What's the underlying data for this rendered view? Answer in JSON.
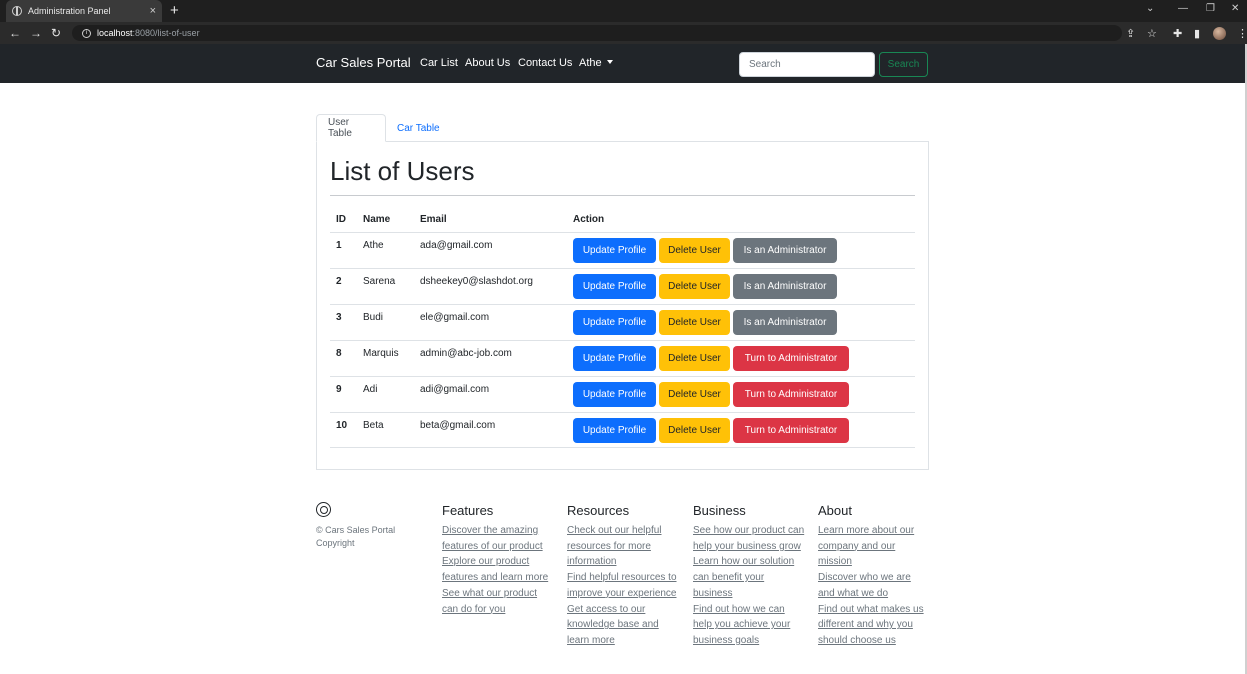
{
  "browser": {
    "tab_title": "Administration Panel",
    "tab_close": "×",
    "new_tab": "+",
    "url_host": "localhost",
    "url_path": ":8080/list-of-user"
  },
  "navbar": {
    "brand": "Car Sales Portal",
    "links": [
      "Car List",
      "About Us",
      "Contact Us",
      "Athe"
    ],
    "search_placeholder": "Search",
    "search_button": "Search"
  },
  "tabs": [
    "User Table",
    "Car Table"
  ],
  "panel": {
    "title": "List of Users",
    "headers": [
      "ID",
      "Name",
      "Email",
      "Action"
    ],
    "rows": [
      {
        "id": "1",
        "name": "Athe",
        "email": "ada@gmail.com",
        "update": "Update Profile",
        "delete": "Delete User",
        "admin": "Is an Administrator",
        "admin_type": "secondary"
      },
      {
        "id": "2",
        "name": "Sarena",
        "email": "dsheekey0@slashdot.org",
        "update": "Update Profile",
        "delete": "Delete User",
        "admin": "Is an Administrator",
        "admin_type": "secondary"
      },
      {
        "id": "3",
        "name": "Budi",
        "email": "ele@gmail.com",
        "update": "Update Profile",
        "delete": "Delete User",
        "admin": "Is an Administrator",
        "admin_type": "secondary"
      },
      {
        "id": "8",
        "name": "Marquis",
        "email": "admin@abc-job.com",
        "update": "Update Profile",
        "delete": "Delete User",
        "admin": "Turn to Administrator",
        "admin_type": "danger"
      },
      {
        "id": "9",
        "name": "Adi",
        "email": "adi@gmail.com",
        "update": "Update Profile",
        "delete": "Delete User",
        "admin": "Turn to Administrator",
        "admin_type": "danger"
      },
      {
        "id": "10",
        "name": "Beta",
        "email": "beta@gmail.com",
        "update": "Update Profile",
        "delete": "Delete User",
        "admin": "Turn to Administrator",
        "admin_type": "danger"
      }
    ]
  },
  "footer": {
    "copyright_line1": "© Cars Sales Portal",
    "copyright_line2": "Copyright",
    "columns": [
      {
        "title": "Features",
        "links": [
          "Discover the amazing features of our product",
          "Explore our product features and learn more",
          "See what our product can do for you"
        ]
      },
      {
        "title": "Resources",
        "links": [
          "Check out our helpful resources for more information",
          "Find helpful resources to improve your experience",
          "Get access to our knowledge base and learn more"
        ]
      },
      {
        "title": "Business",
        "links": [
          "See how our product can help your business grow",
          "Learn how our solution can benefit your business",
          "Find out how we can help you achieve your business goals"
        ]
      },
      {
        "title": "About",
        "links": [
          "Learn more about our company and our mission",
          "Discover who we are and what we do",
          "Find out what makes us different and why you should choose us"
        ]
      }
    ]
  },
  "colors": {
    "navbar_bg": "#212529",
    "primary": "#0d6efd",
    "warning": "#ffc107",
    "secondary": "#6c757d",
    "danger": "#dc3545",
    "success": "#198754"
  },
  "icons": [
    "globe-icon",
    "back-arrow-icon",
    "forward-arrow-icon",
    "reload-icon",
    "info-icon",
    "share-icon",
    "star-icon",
    "puzzle-icon",
    "sidebar-icon",
    "avatar",
    "menu-icon",
    "aperture-logo-icon"
  ]
}
